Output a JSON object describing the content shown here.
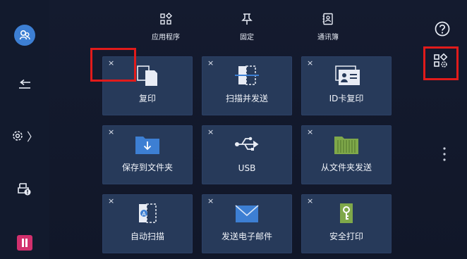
{
  "top_tabs": [
    {
      "label": "应用程序",
      "icon": "apps-grid-icon"
    },
    {
      "label": "固定",
      "icon": "pin-icon"
    },
    {
      "label": "通讯簿",
      "icon": "address-book-icon"
    }
  ],
  "right_controls": {
    "help_icon": "help-icon",
    "customize_icon": "apps-settings-icon"
  },
  "left_rail": {
    "items": [
      "user-icon",
      "back-arrow-icon",
      "gear-icon",
      "printer-status-icon",
      "pause-icon"
    ],
    "gear_chevron": "〉"
  },
  "tiles": [
    {
      "label": "复印",
      "icon": "copy-icon"
    },
    {
      "label": "扫描并发送",
      "icon": "scan-send-icon"
    },
    {
      "label": "ID卡复印",
      "icon": "id-card-copy-icon"
    },
    {
      "label": "保存到文件夹",
      "icon": "save-folder-icon"
    },
    {
      "label": "USB",
      "icon": "usb-icon"
    },
    {
      "label": "从文件夹发送",
      "icon": "send-from-folder-icon"
    },
    {
      "label": "自动扫描",
      "icon": "auto-scan-icon"
    },
    {
      "label": "发送电子邮件",
      "icon": "email-icon"
    },
    {
      "label": "安全打印",
      "icon": "secure-print-icon"
    }
  ],
  "close_glyph": "×",
  "colors": {
    "background": "#111729",
    "tile": "#273a5a",
    "accent_blue": "#3d7fd3",
    "highlight_red": "#e11b1b",
    "pause_pink": "#d2306d"
  }
}
